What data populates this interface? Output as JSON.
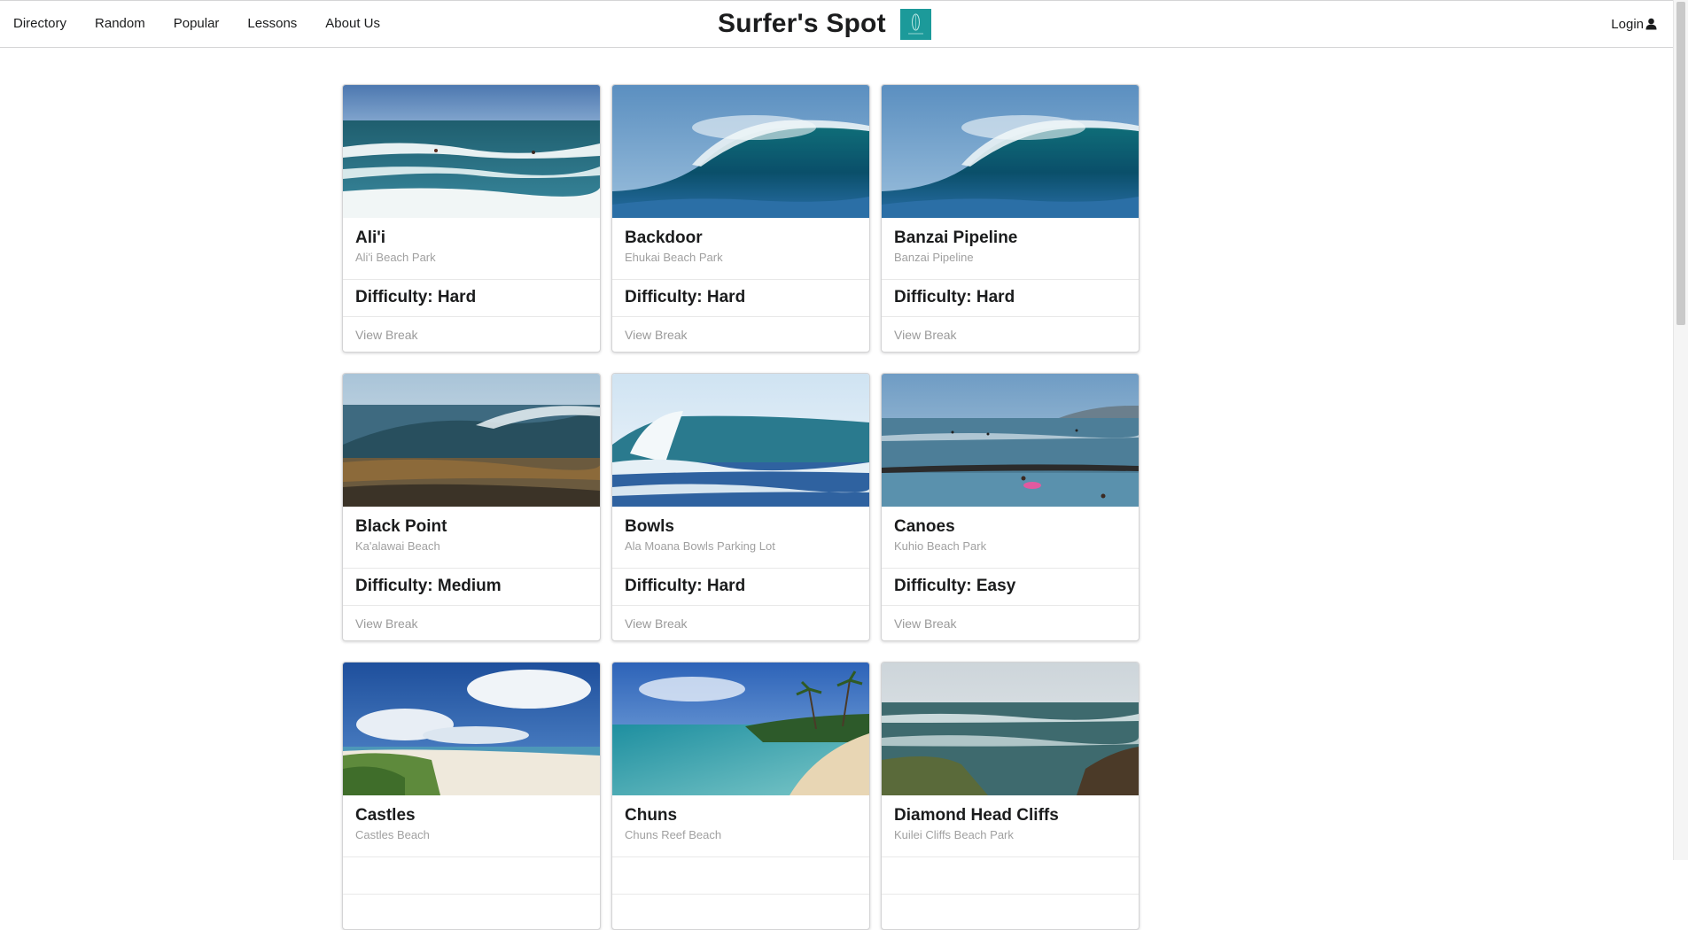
{
  "nav": {
    "items": [
      "Directory",
      "Random",
      "Popular",
      "Lessons",
      "About Us"
    ],
    "brand_title": "Surfer's Spot",
    "login_label": "Login"
  },
  "colors": {
    "brand_teal": "#1c9a9a",
    "muted_text": "#a0a0a0"
  },
  "cards": [
    {
      "title": "Ali'i",
      "location": "Ali'i Beach Park",
      "difficulty": "Difficulty: Hard",
      "link": "View Break",
      "image": "wave-surfers"
    },
    {
      "title": "Backdoor",
      "location": "Ehukai Beach Park",
      "difficulty": "Difficulty: Hard",
      "link": "View Break",
      "image": "barrel-wave"
    },
    {
      "title": "Banzai Pipeline",
      "location": "Banzai Pipeline",
      "difficulty": "Difficulty: Hard",
      "link": "View Break",
      "image": "barrel-wave"
    },
    {
      "title": "Black Point",
      "location": "Ka'alawai Beach",
      "difficulty": "Difficulty: Medium",
      "link": "View Break",
      "image": "rocky-point-wave"
    },
    {
      "title": "Bowls",
      "location": "Ala Moana Bowls Parking Lot",
      "difficulty": "Difficulty: Hard",
      "link": "View Break",
      "image": "breaking-wave"
    },
    {
      "title": "Canoes",
      "location": "Kuhio Beach Park",
      "difficulty": "Difficulty: Easy",
      "link": "View Break",
      "image": "crowded-surf"
    },
    {
      "title": "Castles",
      "location": "Castles Beach",
      "difficulty": "",
      "link": "",
      "image": "beach-clouds"
    },
    {
      "title": "Chuns",
      "location": "Chuns Reef Beach",
      "difficulty": "",
      "link": "",
      "image": "palm-cove"
    },
    {
      "title": "Diamond Head Cliffs",
      "location": "Kuilei Cliffs Beach Park",
      "difficulty": "",
      "link": "",
      "image": "cliff-ocean"
    }
  ]
}
